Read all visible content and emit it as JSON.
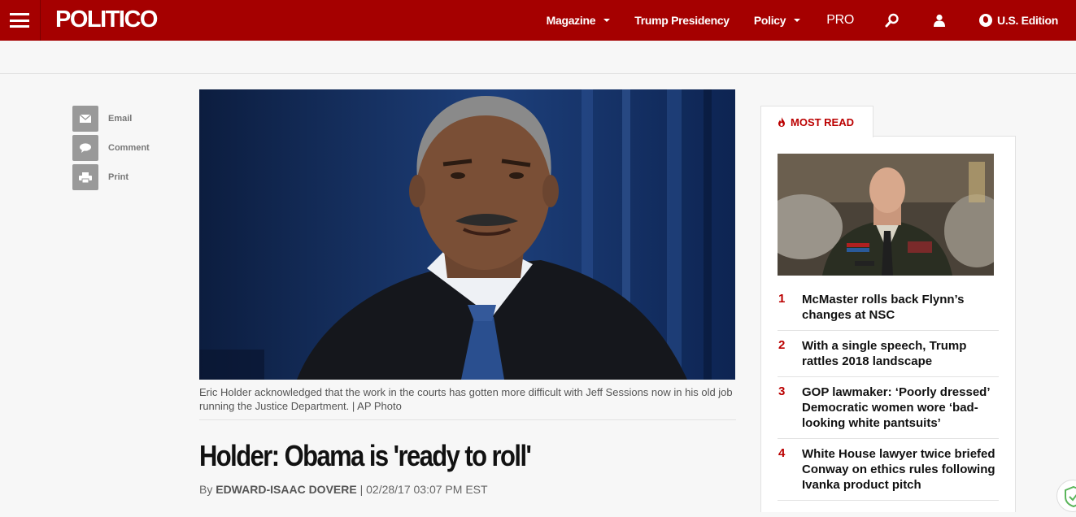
{
  "header": {
    "logo": "POLITICO",
    "nav": [
      {
        "label": "Magazine",
        "dropdown": true
      },
      {
        "label": "Trump Presidency",
        "dropdown": false
      },
      {
        "label": "Policy",
        "dropdown": true
      }
    ],
    "pro_label": "PRO",
    "edition_label": "U.S. Edition",
    "icons": [
      "menu-icon",
      "search-icon",
      "user-icon",
      "globe-icon"
    ],
    "brand_color": "#a50000"
  },
  "share": [
    {
      "label": "Email",
      "icon": "email-icon"
    },
    {
      "label": "Comment",
      "icon": "comment-icon"
    },
    {
      "label": "Print",
      "icon": "print-icon"
    }
  ],
  "article": {
    "caption": "Eric Holder acknowledged that the work in the courts has gotten more difficult with Jeff Sessions now in his old job running the Justice Department. | AP Photo",
    "headline": "Holder: Obama is 'ready to roll'",
    "byline_prefix": "By",
    "author": "EDWARD-ISAAC DOVERE",
    "timestamp": "| 02/28/17 03:07 PM EST"
  },
  "most_read": {
    "tab_label": "MOST READ",
    "items": [
      {
        "num": "1",
        "title": "McMaster rolls back Flynn’s changes at NSC"
      },
      {
        "num": "2",
        "title": "With a single speech, Trump rattles 2018 landscape"
      },
      {
        "num": "3",
        "title": "GOP lawmaker: ‘Poorly dressed’ Democratic women wore ‘bad-looking white pantsuits’"
      },
      {
        "num": "4",
        "title": "White House lawyer twice briefed Conway on ethics rules following Ivanka product pitch"
      }
    ]
  }
}
